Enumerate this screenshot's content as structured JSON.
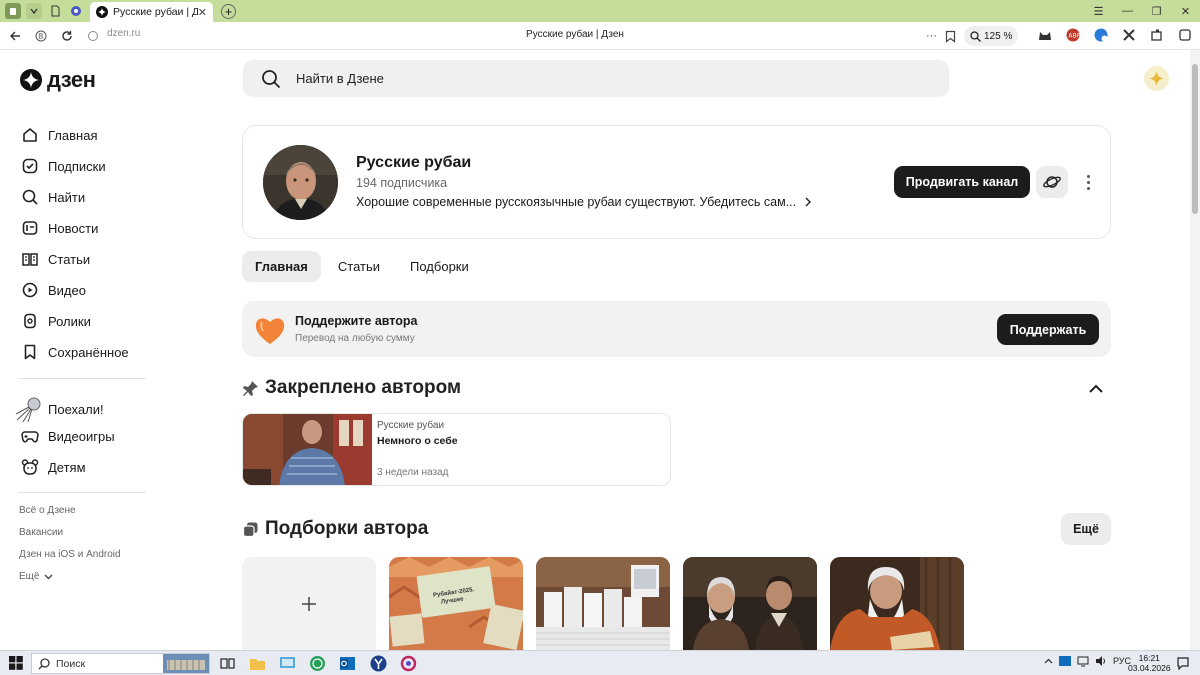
{
  "browser": {
    "tab_title": "Русские рубаи | Дзен",
    "url": "dzen.ru",
    "page_title": "Русские рубаи | Дзен",
    "zoom": "125 %"
  },
  "brand": {
    "logo_text": "дзен"
  },
  "search": {
    "placeholder": "Найти в Дзене"
  },
  "sidebar": {
    "main": [
      "Главная",
      "Подписки",
      "Найти",
      "Новости",
      "Статьи",
      "Видео",
      "Ролики",
      "Сохранённое"
    ],
    "extra": [
      "Поехали!",
      "Видеоигры",
      "Детям"
    ],
    "footer": [
      "Всё о Дзене",
      "Вакансии",
      "Дзен на iOS и Android",
      "Ещё"
    ]
  },
  "channel": {
    "name": "Русские рубаи",
    "subscribers": "194 подписчика",
    "description": "Хорошие современные русскоязычные рубаи существуют. Убедитесь сам...",
    "promote_label": "Продвигать канал"
  },
  "tabs": [
    "Главная",
    "Статьи",
    "Подборки"
  ],
  "support": {
    "title": "Поддержите автора",
    "subtitle": "Перевод на любую сумму",
    "button": "Поддержать"
  },
  "pinned": {
    "heading": "Закреплено автором",
    "card": {
      "source": "Русские рубаи",
      "title": "Немного о себе",
      "time": "3 недели назад"
    }
  },
  "collections": {
    "heading": "Подборки автора",
    "more_label": "Ещё",
    "book_cover_text": [
      "Рубайат-2025.",
      "Лучшее"
    ]
  },
  "taskbar": {
    "search_label": "Поиск",
    "lang": "РУС",
    "time": "16:21",
    "date": "03.04.2026"
  },
  "colors": {
    "accent_dark": "#1c1c1c",
    "tab_strip": "#c5dd9a",
    "heart": "#f2843a"
  }
}
